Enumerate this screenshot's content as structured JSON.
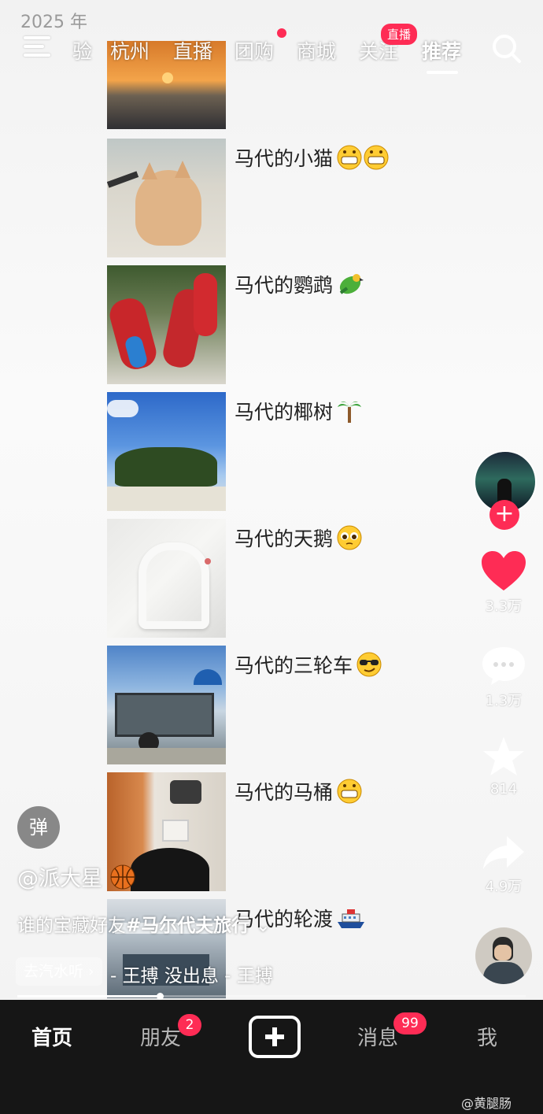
{
  "status": {
    "year": "2025 年"
  },
  "topnav": {
    "tabs": [
      {
        "label": "验"
      },
      {
        "label": "杭州"
      },
      {
        "label": "直播"
      },
      {
        "label": "团购"
      },
      {
        "label": "商城"
      },
      {
        "label": "关注"
      },
      {
        "label": "推荐"
      }
    ],
    "live_badge": "直播"
  },
  "feed": [
    {
      "caption": "马代的小猫",
      "emoji": "grin-grin"
    },
    {
      "caption": "马代的鹦鹉",
      "emoji": "parrot"
    },
    {
      "caption": "马代的椰树",
      "emoji": "palm-tree"
    },
    {
      "caption": "马代的天鹅",
      "emoji": "pleading-face"
    },
    {
      "caption": "马代的三轮车",
      "emoji": "sunglasses-face"
    },
    {
      "caption": "马代的马桶",
      "emoji": "grin"
    },
    {
      "caption": "马代的轮渡",
      "emoji": "ship"
    }
  ],
  "side": {
    "likes": "3.3万",
    "comments": "1.3万",
    "favorites": "814",
    "shares": "4.9万"
  },
  "danmu": "弹",
  "author": {
    "username": "@派大星",
    "description_prefix": "谁的宝藏好友",
    "description_tag": "#马尔代夫旅行",
    "description_more": "⌄",
    "music_chip": "去汽水听 ›",
    "music_text": "- 王搏   没出息 - 王搏"
  },
  "progress": 0.28,
  "bottomnav": {
    "home": "首页",
    "friends": "朋友",
    "friends_badge": "2",
    "messages": "消息",
    "messages_badge": "99",
    "me": "我"
  },
  "watermark": "@黄腿肠",
  "colors": {
    "accent": "#fe2c55",
    "nav_bg": "#161616"
  }
}
